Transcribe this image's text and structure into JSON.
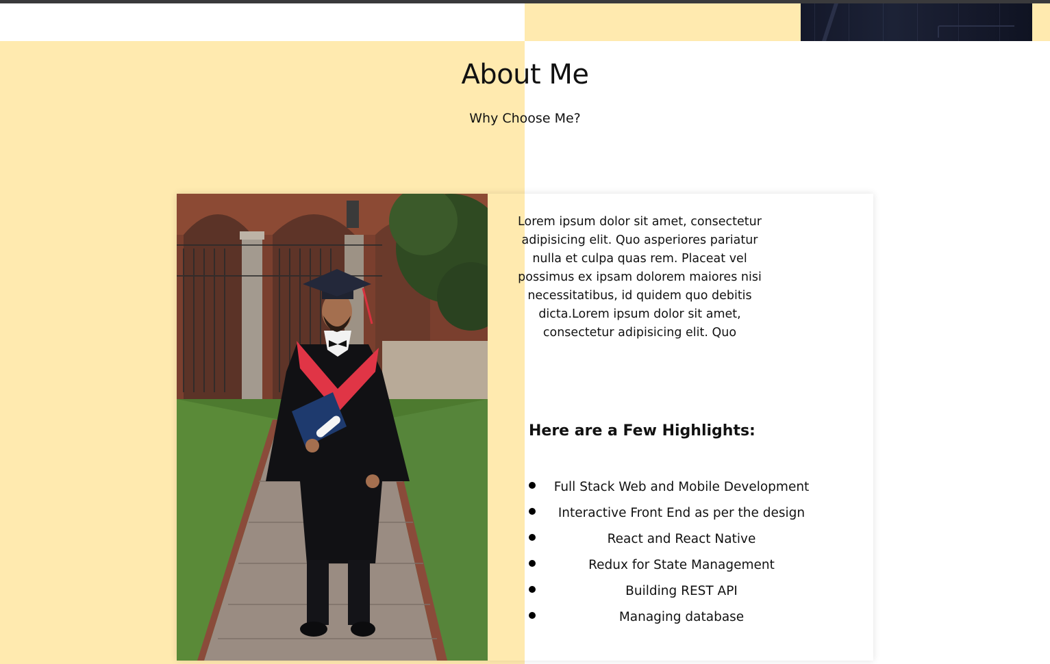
{
  "colors": {
    "accent_yellow": "#ffeaaf",
    "text": "#111111",
    "top_bar": "#3a3a3c",
    "bullet": "#000000"
  },
  "hero_fragment": {
    "description_icon": "suit-photo"
  },
  "about": {
    "title": "About Me",
    "subtitle": "Why Choose Me?",
    "photo_icon": "graduate-photo",
    "intro": "Lorem ipsum dolor sit amet, consectetur adipisicing elit. Quo asperiores pariatur nulla et culpa quas rem. Placeat vel possimus ex ipsam dolorem maiores nisi necessitatibus, id quidem quo debitis dicta.Lorem ipsum dolor sit amet, consectetur adipisicing elit. Quo",
    "highlights_title": "Here are a Few Highlights:",
    "highlights": [
      "Full Stack Web and Mobile Development",
      "Interactive Front End as per the design",
      "React and React Native",
      "Redux for State Management",
      "Building REST API",
      "Managing database"
    ]
  }
}
